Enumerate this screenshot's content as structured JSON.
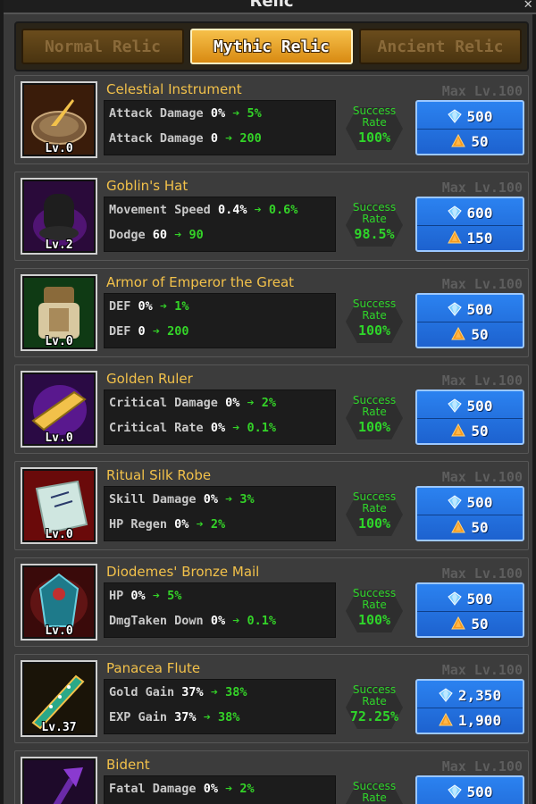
{
  "window": {
    "title": "Relic"
  },
  "tabs": [
    {
      "label": "Normal Relic",
      "active": false
    },
    {
      "label": "Mythic Relic",
      "active": true
    },
    {
      "label": "Ancient Relic",
      "active": false
    }
  ],
  "labels": {
    "success_rate_line1": "Success",
    "success_rate_line2": "Rate",
    "arrow": "➔"
  },
  "colors": {
    "name": "#f2c14a",
    "stat_gain": "#34d428",
    "cost_button": "#2b82f0",
    "tab_active": "#f6c04a"
  },
  "relics": [
    {
      "name": "Celestial Instrument",
      "level": "Lv.0",
      "max_level": "Max Lv.100",
      "icon": "sundial-icon",
      "stats": [
        {
          "name": "Attack Damage",
          "from": "0%",
          "to": "5%"
        },
        {
          "name": "Attack Damage",
          "from": "0",
          "to": "200"
        }
      ],
      "success_rate": "100%",
      "cost_gems": "500",
      "cost_gold": "50"
    },
    {
      "name": "Goblin's Hat",
      "level": "Lv.2",
      "max_level": "Max Lv.100",
      "icon": "hat-icon",
      "stats": [
        {
          "name": "Movement Speed",
          "from": "0.4%",
          "to": "0.6%"
        },
        {
          "name": "Dodge",
          "from": "60",
          "to": "90"
        }
      ],
      "success_rate": "98.5%",
      "cost_gems": "600",
      "cost_gold": "150"
    },
    {
      "name": "Armor of Emperor the Great",
      "level": "Lv.0",
      "max_level": "Max Lv.100",
      "icon": "armor-icon",
      "stats": [
        {
          "name": "DEF",
          "from": "0%",
          "to": "1%"
        },
        {
          "name": "DEF",
          "from": "0",
          "to": "200"
        }
      ],
      "success_rate": "100%",
      "cost_gems": "500",
      "cost_gold": "50"
    },
    {
      "name": "Golden Ruler",
      "level": "Lv.0",
      "max_level": "Max Lv.100",
      "icon": "ruler-icon",
      "stats": [
        {
          "name": "Critical Damage",
          "from": "0%",
          "to": "2%"
        },
        {
          "name": "Critical Rate",
          "from": "0%",
          "to": "0.1%"
        }
      ],
      "success_rate": "100%",
      "cost_gems": "500",
      "cost_gold": "50"
    },
    {
      "name": "Ritual Silk Robe",
      "level": "Lv.0",
      "max_level": "Max Lv.100",
      "icon": "robe-icon",
      "stats": [
        {
          "name": "Skill Damage",
          "from": "0%",
          "to": "3%"
        },
        {
          "name": "HP Regen",
          "from": "0%",
          "to": "2%"
        }
      ],
      "success_rate": "100%",
      "cost_gems": "500",
      "cost_gold": "50"
    },
    {
      "name": "Diodemes' Bronze Mail",
      "level": "Lv.0",
      "max_level": "Max Lv.100",
      "icon": "mail-icon",
      "stats": [
        {
          "name": "HP",
          "from": "0%",
          "to": "5%"
        },
        {
          "name": "DmgTaken Down",
          "from": "0%",
          "to": "0.1%"
        }
      ],
      "success_rate": "100%",
      "cost_gems": "500",
      "cost_gold": "50"
    },
    {
      "name": "Panacea Flute",
      "level": "Lv.37",
      "max_level": "Max Lv.100",
      "icon": "flute-icon",
      "stats": [
        {
          "name": "Gold Gain",
          "from": "37%",
          "to": "38%"
        },
        {
          "name": "EXP Gain",
          "from": "37%",
          "to": "38%"
        }
      ],
      "success_rate": "72.25%",
      "cost_gems": "2,350",
      "cost_gold": "1,900"
    },
    {
      "name": "Bident",
      "level": "",
      "max_level": "Max Lv.100",
      "icon": "bident-icon",
      "stats": [
        {
          "name": "Fatal Damage",
          "from": "0%",
          "to": "2%"
        }
      ],
      "success_rate": "",
      "cost_gems": "500",
      "cost_gold": ""
    }
  ]
}
